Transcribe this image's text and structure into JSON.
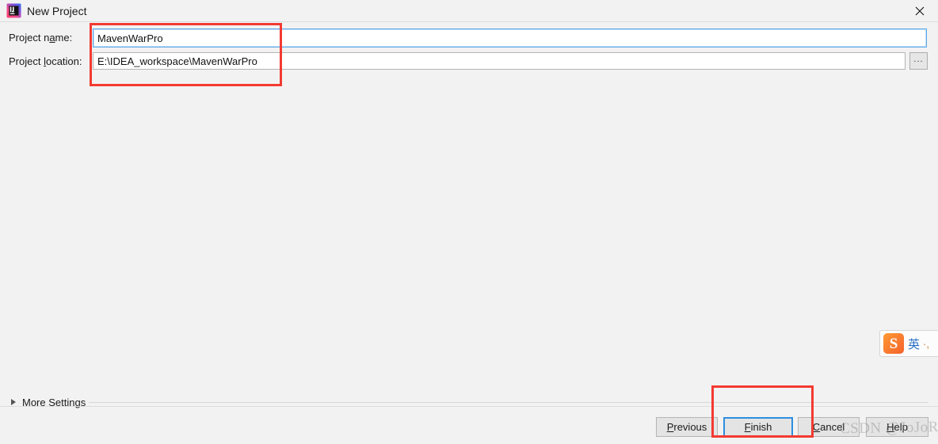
{
  "window": {
    "title": "New Project",
    "app_icon": "intellij-idea-icon",
    "close_icon": "close-icon"
  },
  "form": {
    "project_name": {
      "label_pre": "Project n",
      "label_mnemonic": "a",
      "label_post": "me:",
      "label_full": "Project name:",
      "value": "MavenWarPro"
    },
    "project_location": {
      "label_pre": "Project ",
      "label_mnemonic": "l",
      "label_post": "ocation:",
      "label_full": "Project location:",
      "value": "E:\\IDEA_workspace\\MavenWarPro",
      "browse_label": "..."
    }
  },
  "more_settings": {
    "label": "More Settings",
    "expander_icon": "chevron-right-icon",
    "expanded": "false"
  },
  "buttons": {
    "previous": {
      "pre": "",
      "mn": "P",
      "post": "revious",
      "full": "Previous"
    },
    "finish": {
      "pre": "",
      "mn": "F",
      "post": "inish",
      "full": "Finish"
    },
    "cancel": {
      "pre": "",
      "mn": "C",
      "post": "ancel",
      "full": "Cancel"
    },
    "help": {
      "pre": "",
      "mn": "H",
      "post": "elp",
      "full": "Help"
    }
  },
  "ime": {
    "logo_letter": "S",
    "mode": "英",
    "dots": "·,"
  },
  "watermark": {
    "text": "CSDN @JoJoRey"
  },
  "annotations": {
    "fields_highlight_color": "#f33a32",
    "finish_highlight_color": "#f33a32"
  },
  "colors": {
    "dialog_background": "#f2f2f2",
    "field_focus_border": "#5ba7e8",
    "default_button_border": "#2d8fe0",
    "annotation_red": "#f33a32"
  }
}
